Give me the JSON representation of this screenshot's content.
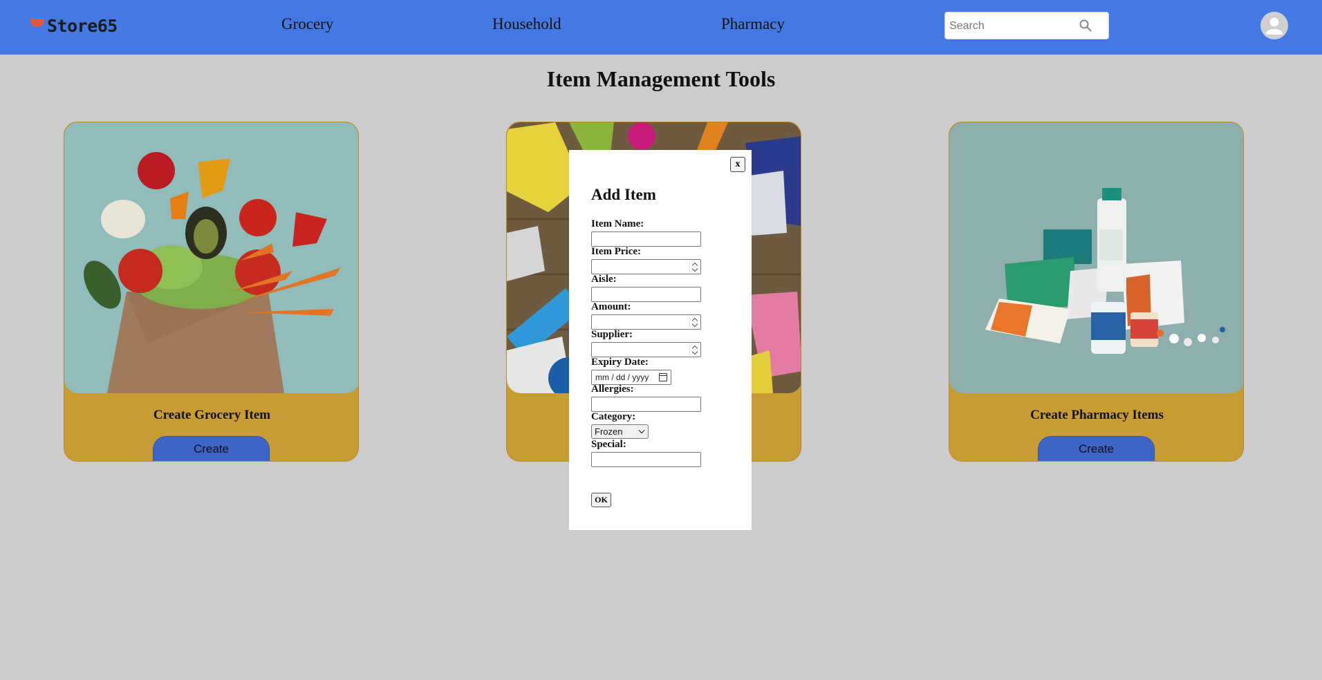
{
  "brand": {
    "name": "Store65",
    "accent": "#e2573a",
    "header_color": "#4479e4"
  },
  "nav": {
    "items": [
      "Grocery",
      "Household",
      "Pharmacy"
    ]
  },
  "search": {
    "placeholder": "Search",
    "value": ""
  },
  "page": {
    "title": "Item Management Tools"
  },
  "cards": [
    {
      "title": "Create Grocery Item",
      "button": "Create",
      "image": "grocery bag with vegetables"
    },
    {
      "title": "",
      "button": "",
      "image": "cleaning supplies and gloves"
    },
    {
      "title": "Create Pharmacy Items",
      "button": "Create",
      "image": "pharmacy boxes and bottles"
    }
  ],
  "modal": {
    "close_label": "x",
    "title": "Add Item",
    "fields": {
      "item_name": {
        "label": "Item Name:",
        "value": ""
      },
      "item_price": {
        "label": "Item Price:",
        "value": ""
      },
      "aisle": {
        "label": "Aisle:",
        "value": ""
      },
      "amount": {
        "label": "Amount:",
        "value": ""
      },
      "supplier": {
        "label": "Supplier:",
        "value": ""
      },
      "expiry_date": {
        "label": "Expiry Date:",
        "placeholder": "mm / dd / yyyy"
      },
      "allergies": {
        "label": "Allergies:",
        "value": ""
      },
      "category": {
        "label": "Category:",
        "selected": "Frozen"
      },
      "special": {
        "label": "Special:",
        "value": ""
      }
    },
    "ok_label": "OK"
  },
  "icons": {
    "search": "search-icon",
    "avatar": "user-avatar-icon",
    "calendar": "calendar-icon",
    "close": "close-icon"
  }
}
